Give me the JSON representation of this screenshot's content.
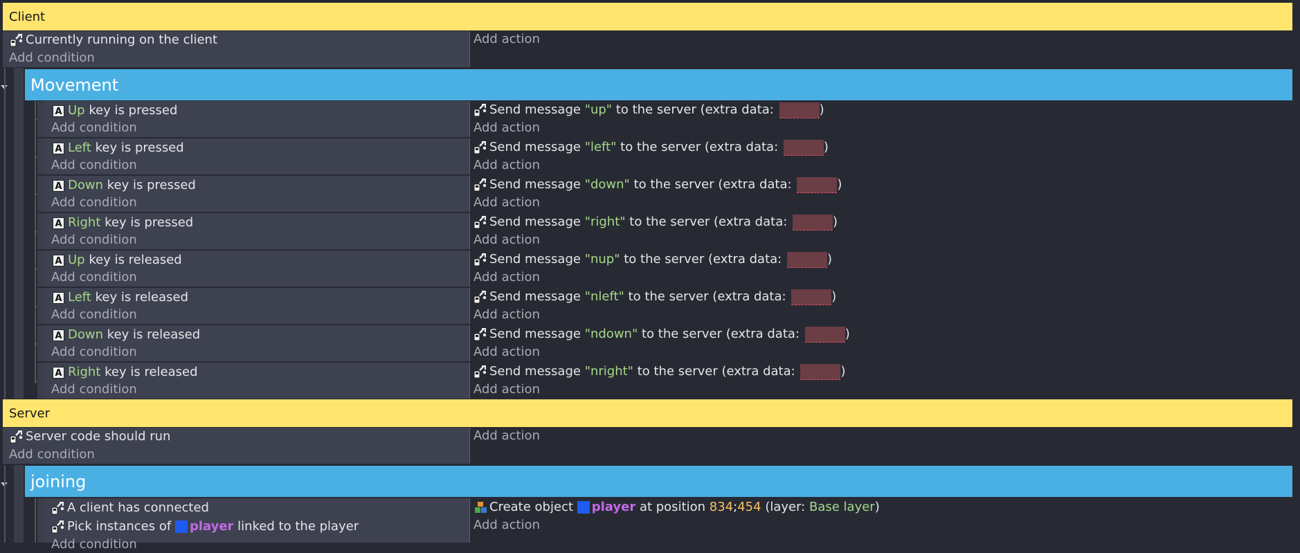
{
  "client_section": {
    "comment": "Client",
    "event": {
      "condition": "Currently running on the client",
      "add_condition": "Add condition",
      "add_action": "Add action"
    },
    "group_title": "Movement",
    "key_events": [
      {
        "key": "Up",
        "cond_rest": "key is pressed",
        "msg": "\"up\"",
        "add_condition": "Add condition",
        "add_action": "Add action"
      },
      {
        "key": "Left",
        "cond_rest": "key is pressed",
        "msg": "\"left\"",
        "add_condition": "Add condition",
        "add_action": "Add action"
      },
      {
        "key": "Down",
        "cond_rest": "key is pressed",
        "msg": "\"down\"",
        "add_condition": "Add condition",
        "add_action": "Add action"
      },
      {
        "key": "Right",
        "cond_rest": "key is pressed",
        "msg": "\"right\"",
        "add_condition": "Add condition",
        "add_action": "Add action"
      },
      {
        "key": "Up",
        "cond_rest": "key is released",
        "msg": "\"nup\"",
        "add_condition": "Add condition",
        "add_action": "Add action"
      },
      {
        "key": "Left",
        "cond_rest": "key is released",
        "msg": "\"nleft\"",
        "add_condition": "Add condition",
        "add_action": "Add action"
      },
      {
        "key": "Down",
        "cond_rest": "key is released",
        "msg": "\"ndown\"",
        "add_condition": "Add condition",
        "add_action": "Add action"
      },
      {
        "key": "Right",
        "cond_rest": "key is released",
        "msg": "\"nright\"",
        "add_condition": "Add condition",
        "add_action": "Add action"
      }
    ],
    "send_prefix": "Send message",
    "send_suffix": "to the server (extra data:",
    "close_paren": ")"
  },
  "server_section": {
    "comment": "Server",
    "event": {
      "condition": "Server code should run",
      "add_condition": "Add condition",
      "add_action": "Add action"
    },
    "group_title": "joining",
    "join_event": {
      "cond1": "A client has connected",
      "cond2_prefix": "Pick instances of",
      "cond2_obj": "player",
      "cond2_suffix": "linked to the player",
      "add_condition": "Add condition",
      "act_prefix": "Create object",
      "act_obj": "player",
      "act_at": "at position",
      "act_x": "834",
      "act_sep": ";",
      "act_y": "454",
      "act_layer_prefix": "(layer:",
      "act_layer": "Base layer",
      "act_layer_suffix": ")",
      "add_action": "Add action"
    }
  },
  "colors": {
    "comment_bg": "#ffe56d",
    "group_bg": "#4ab0e4",
    "param_green": "#a7d889",
    "param_orange": "#f5c266",
    "object_purple": "#c36ae6"
  }
}
